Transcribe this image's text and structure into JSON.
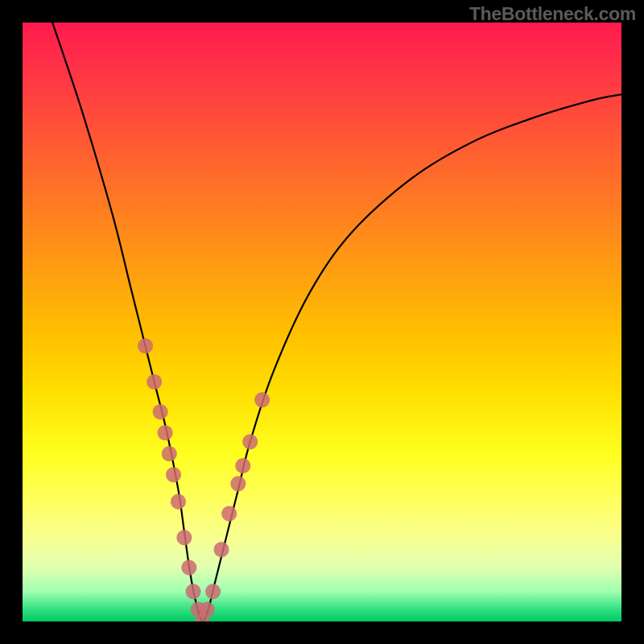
{
  "domain": "Chart",
  "watermark": "TheBottleneck.com",
  "chart_data": {
    "type": "line",
    "title": "",
    "xlabel": "",
    "ylabel": "",
    "xlim": [
      0,
      100
    ],
    "ylim": [
      0,
      100
    ],
    "series": [
      {
        "name": "curve",
        "x": [
          5,
          10,
          15,
          18,
          20,
          22,
          24,
          26,
          27,
          28,
          29,
          30,
          31,
          32,
          34,
          36,
          38,
          42,
          48,
          55,
          65,
          75,
          85,
          95,
          100
        ],
        "y": [
          100,
          85,
          68,
          56,
          48,
          40,
          32,
          22,
          15,
          8,
          3,
          0,
          2,
          6,
          14,
          22,
          30,
          42,
          55,
          65,
          74,
          80,
          84,
          87,
          88
        ]
      }
    ],
    "markers": {
      "name": "dots",
      "x": [
        20.5,
        22,
        23,
        23.8,
        24.5,
        25.2,
        26,
        27,
        27.8,
        28.5,
        29.3,
        30,
        30.8,
        31.8,
        33.2,
        34.5,
        36,
        36.8,
        38,
        40
      ],
      "y": [
        46,
        40,
        35,
        31.5,
        28,
        24.5,
        20,
        14,
        9,
        5,
        2,
        0,
        2,
        5,
        12,
        18,
        23,
        26,
        30,
        37
      ]
    },
    "gradient_stops": [
      {
        "pos": 0.0,
        "color": "#ff1a4d"
      },
      {
        "pos": 0.5,
        "color": "#ffc000"
      },
      {
        "pos": 0.8,
        "color": "#ffff60"
      },
      {
        "pos": 1.0,
        "color": "#00c860"
      }
    ]
  }
}
